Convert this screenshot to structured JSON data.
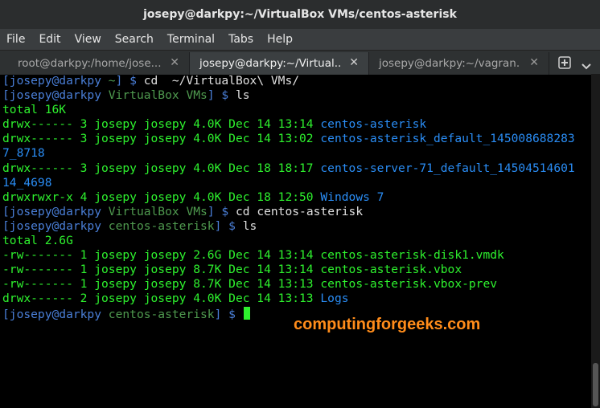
{
  "window": {
    "title": "josepy@darkpy:~/VirtualBox VMs/centos-asterisk"
  },
  "menu": [
    "File",
    "Edit",
    "View",
    "Search",
    "Terminal",
    "Tabs",
    "Help"
  ],
  "tabs": [
    {
      "label": "root@darkpy:/home/jose..."
    },
    {
      "label": "josepy@darkpy:~/Virtual..."
    },
    {
      "label": "josepy@darkpy:~/vagran..."
    }
  ],
  "icons": {
    "close": "close-icon",
    "add_tab": "plus-icon",
    "tab_menu": "chevron-down-icon"
  },
  "colors": {
    "prompt_green": "#2ef22e",
    "dir_blue": "#2a8df5",
    "watermark_orange": "#ff8c1a"
  },
  "terminal": {
    "lines": [
      {
        "user": "[josepy@darkpy ",
        "dir": "~",
        "tail": "] $ ",
        "cmd": "cd  ~/VirtualBox\\ VMs/"
      },
      {
        "user": "[josepy@darkpy ",
        "dir": "VirtualBox VMs",
        "tail": "] $ ",
        "cmd": "ls"
      },
      {
        "text": "total 16K"
      },
      {
        "meta": "drwx------ 3 josepy josepy 4.0K Dec 14 13:14 ",
        "name": "centos-asterisk"
      },
      {
        "meta": "drwx------ 3 josepy josepy 4.0K Dec 14 13:02 ",
        "name": "centos-asterisk_default_145008688283"
      },
      {
        "name": "7_8718"
      },
      {
        "meta": "drwx------ 3 josepy josepy 4.0K Dec 18 18:17 ",
        "name": "centos-server-71_default_14504514601"
      },
      {
        "name": "14_4698"
      },
      {
        "meta": "drwxrwxr-x 4 josepy josepy 4.0K Dec 18 12:50 ",
        "name": "Windows 7"
      },
      {
        "user": "[josepy@darkpy ",
        "dir": "VirtualBox VMs",
        "tail": "] $ ",
        "cmd": "cd centos-asterisk"
      },
      {
        "user": "[josepy@darkpy ",
        "dir": "centos-asterisk",
        "tail": "] $ ",
        "cmd": "ls"
      },
      {
        "text": "total 2.6G"
      },
      {
        "meta": "-rw------- 1 josepy josepy 2.6G Dec 14 13:14 ",
        "file": "centos-asterisk-disk1.vmdk"
      },
      {
        "meta": "-rw------- 1 josepy josepy 8.7K Dec 14 13:14 ",
        "file": "centos-asterisk.vbox"
      },
      {
        "meta": "-rw------- 1 josepy josepy 8.7K Dec 14 13:13 ",
        "file": "centos-asterisk.vbox-prev"
      },
      {
        "meta": "drwx------ 2 josepy josepy 4.0K Dec 14 13:13 ",
        "name": "Logs"
      },
      {
        "user": "[josepy@darkpy ",
        "dir": "centos-asterisk",
        "tail": "] $ ",
        "cmd": ""
      }
    ]
  },
  "watermark": "computingforgeeks.com"
}
